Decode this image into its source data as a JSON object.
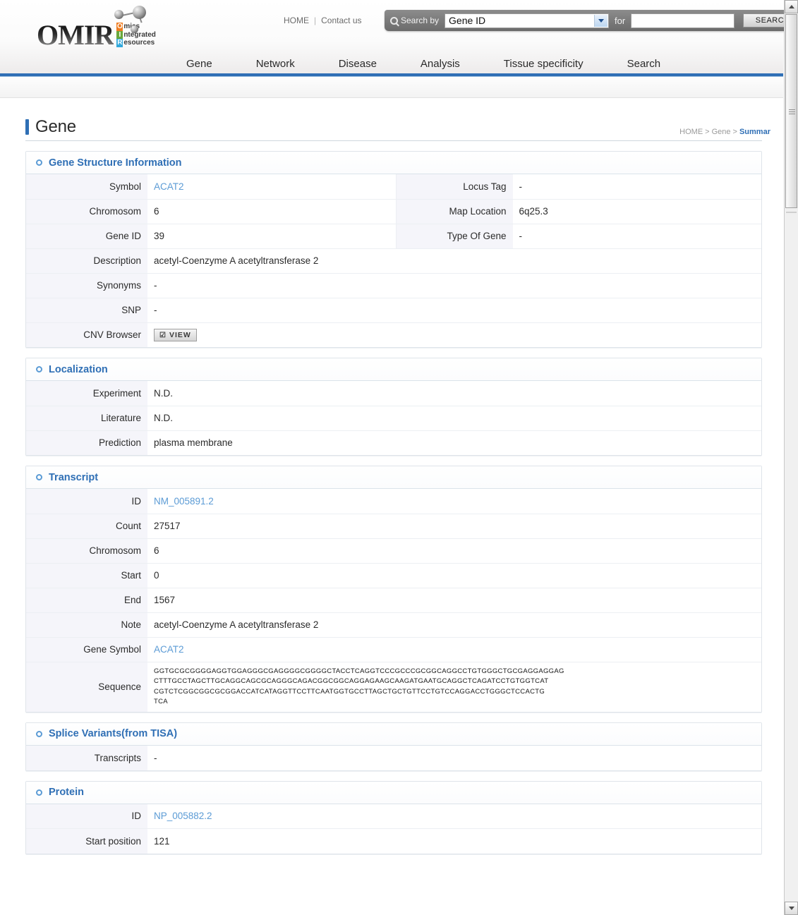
{
  "header": {
    "logo_main": "OMIR",
    "logo_lines": [
      {
        "first": "O",
        "rest": "mics"
      },
      {
        "first": "I",
        "rest": "ntegrated"
      },
      {
        "first": "R",
        "rest": "esources"
      }
    ],
    "home_link": "HOME",
    "separator": "|",
    "contact_link": "Contact us",
    "search_by_label": "Search by",
    "search_by_value": "Gene ID",
    "for_label": "for",
    "search_input_value": "",
    "search_input_placeholder": "",
    "search_button": "SEARCH"
  },
  "nav": {
    "items": [
      {
        "label": "Gene"
      },
      {
        "label": "Network"
      },
      {
        "label": "Disease"
      },
      {
        "label": "Analysis"
      },
      {
        "label": "Tissue specificity"
      },
      {
        "label": "Search"
      }
    ]
  },
  "page": {
    "title": "Gene",
    "breadcrumb": {
      "home": "HOME",
      "chev1": ">",
      "section": "Gene",
      "chev2": ">",
      "current": "Summar"
    }
  },
  "sections": {
    "gene_structure": {
      "title": "Gene Structure Information",
      "rows": [
        {
          "k": "Symbol",
          "v": "ACAT2",
          "k2": "Locus Tag",
          "v2": "-"
        },
        {
          "k": "Chromosom",
          "v": "6",
          "k2": "Map Location",
          "v2": "6q25.3"
        },
        {
          "k": "Gene ID",
          "v": "39",
          "k2": "Type Of Gene",
          "v2": "-"
        }
      ],
      "wide_rows": [
        {
          "k": "Description",
          "v": "acetyl-Coenzyme A acetyltransferase 2"
        },
        {
          "k": "Synonyms",
          "v": "-"
        },
        {
          "k": "SNP",
          "v": "-"
        }
      ],
      "cnv_label": "CNV Browser",
      "cnv_button": "VIEW",
      "cnv_button_icon": "☑"
    },
    "localization": {
      "title": "Localization",
      "rows": [
        {
          "k": "Experiment",
          "v": "N.D."
        },
        {
          "k": "Literature",
          "v": "N.D."
        },
        {
          "k": "Prediction",
          "v": "plasma membrane"
        }
      ]
    },
    "transcript": {
      "title": "Transcript",
      "rows": [
        {
          "k": "ID",
          "v": "NM_005891.2",
          "link": true
        },
        {
          "k": "Count",
          "v": "27517"
        },
        {
          "k": "Chromosom",
          "v": "6"
        },
        {
          "k": "Start",
          "v": "0"
        },
        {
          "k": "End",
          "v": "1567"
        },
        {
          "k": "Note",
          "v": "acetyl-Coenzyme A acetyltransferase 2"
        },
        {
          "k": "Gene Symbol",
          "v": "ACAT2",
          "link": true
        }
      ],
      "sequence_label": "Sequence",
      "sequence": "GGTGCGCGGGGAGGTGGAGGGCGAGGGGCGGGGCTACCTCAGGTCCCGCCCGCGGCAGGCCTGTGGGCTGCGAGGAGGAG\nCTTTGCCTAGCTTGCAGGCAGCGCAGGGCAGACGGCGGCAGGAGAAGCAAGATGAATGCAGGCTCAGATCCTGTGGTCAT\nCGTCTCGGCGGCGCGGACCATCATAGGTTCCTTCAATGGTGCCTTAGCTGCTGTTCCTGTCCAGGACCTGGGCTCCACTG\nTCA"
    },
    "splice_variants": {
      "title": "Splice Variants(from TISA)",
      "rows": [
        {
          "k": "Transcripts",
          "v": "-"
        }
      ]
    },
    "protein": {
      "title": "Protein",
      "rows": [
        {
          "k": "ID",
          "v": "NP_005882.2",
          "link": true
        },
        {
          "k": "Start position",
          "v": "121"
        }
      ]
    }
  },
  "scrollbar": {
    "up_arrow": "up-arrow",
    "down_arrow": "down-arrow"
  }
}
